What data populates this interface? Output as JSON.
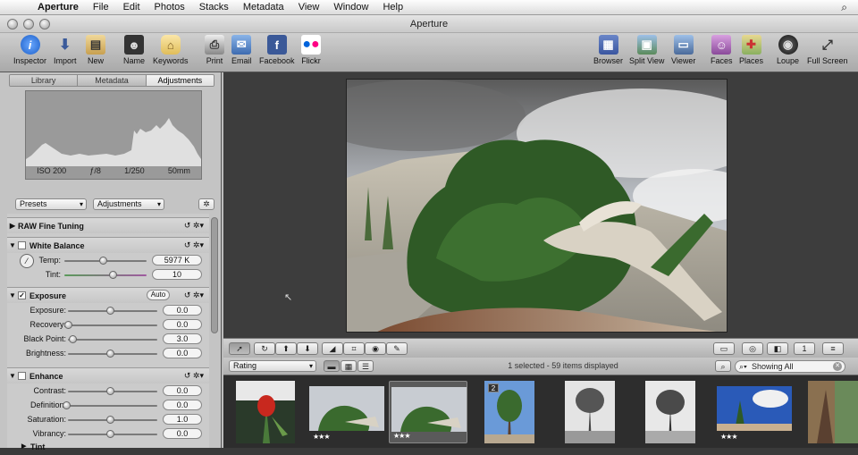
{
  "menubar": {
    "app": "Aperture",
    "items": [
      "File",
      "Edit",
      "Photos",
      "Stacks",
      "Metadata",
      "View",
      "Window",
      "Help"
    ]
  },
  "window": {
    "title": "Aperture"
  },
  "toolbar": {
    "inspector": "Inspector",
    "import": "Import",
    "new": "New",
    "name": "Name",
    "keywords": "Keywords",
    "print": "Print",
    "email": "Email",
    "facebook": "Facebook",
    "flickr": "Flickr",
    "browser": "Browser",
    "split_view": "Split View",
    "viewer": "Viewer",
    "faces": "Faces",
    "places": "Places",
    "loupe": "Loupe",
    "full_screen": "Full Screen"
  },
  "inspector": {
    "tabs": [
      "Library",
      "Metadata",
      "Adjustments"
    ],
    "exif": [
      "ISO 200",
      "ƒ/8",
      "1/250",
      "50mm"
    ],
    "presets": "Presets",
    "adjustments": "Adjustments"
  },
  "adjustments": {
    "raw_fine_tuning": "RAW Fine Tuning",
    "white_balance": {
      "title": "White Balance",
      "temp_label": "Temp:",
      "temp_value": "5977 K",
      "tint_label": "Tint:",
      "tint_value": "10"
    },
    "exposure": {
      "title": "Exposure",
      "auto": "Auto",
      "exposure_label": "Exposure:",
      "exposure_value": "0.0",
      "recovery_label": "Recovery:",
      "recovery_value": "0.0",
      "black_point_label": "Black Point:",
      "black_point_value": "3.0",
      "brightness_label": "Brightness:",
      "brightness_value": "0.0"
    },
    "enhance": {
      "title": "Enhance",
      "contrast_label": "Contrast:",
      "contrast_value": "0.0",
      "definition_label": "Definition:",
      "definition_value": "0.0",
      "saturation_label": "Saturation:",
      "saturation_value": "1.0",
      "vibrancy_label": "Vibrancy:",
      "vibrancy_value": "0.0",
      "tint_label": "Tint"
    }
  },
  "browser": {
    "sort": "Rating",
    "status": "1 selected - 59 items displayed",
    "filter": "Showing All"
  },
  "filmstrip": {
    "stack_badge": "2",
    "rating_stars": "★★★"
  }
}
